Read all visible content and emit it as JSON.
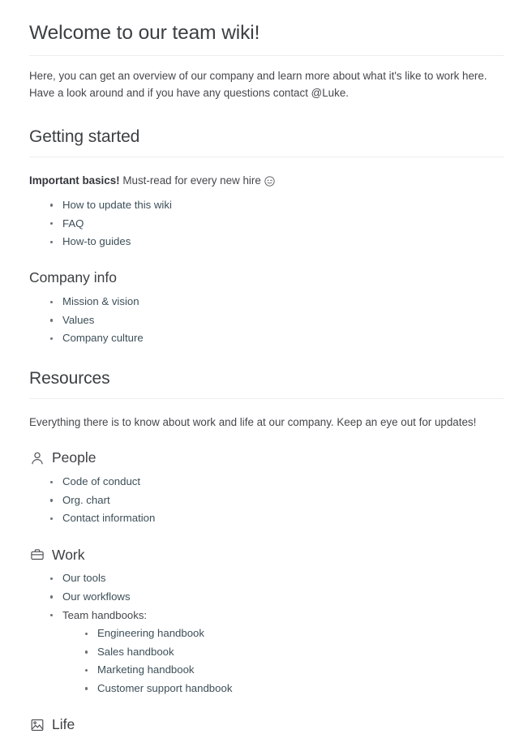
{
  "document": {
    "title": "Welcome to our team wiki!",
    "intro": "Here, you can get an overview of our company and learn more about what it's like to work here. Have a look around and if you have any questions contact @Luke."
  },
  "getting_started": {
    "heading": "Getting started",
    "lead_strong": "Important basics!",
    "lead_rest": " Must-read for every new hire ",
    "lead_emoji": "wink-face-icon",
    "links": [
      "How to update this wiki",
      "FAQ",
      "How-to guides"
    ],
    "company_info": {
      "heading": "Company info",
      "links": [
        "Mission & vision",
        "Values",
        "Company culture"
      ]
    }
  },
  "resources": {
    "heading": "Resources",
    "intro": "Everything there is to know about work and life at our company. Keep an eye out for updates!",
    "sections": [
      {
        "heading": "People",
        "icon": "person-bust-icon",
        "links": [
          "Code of conduct",
          "Org. chart",
          "Contact information"
        ]
      },
      {
        "heading": "Work",
        "icon": "briefcase-icon",
        "links": [
          "Our tools",
          "Our workflows"
        ],
        "group_label": "Team handbooks:",
        "group_links": [
          "Engineering handbook",
          "Sales handbook",
          "Marketing handbook",
          "Customer support handbook"
        ]
      },
      {
        "heading": "Life",
        "icon": "framed-picture-icon",
        "links": []
      }
    ]
  },
  "colors": {
    "text": "#36393d",
    "heading": "#3c4043",
    "link": "#3d4f58",
    "rule": "#edeeef",
    "bullet": "#6b7075"
  }
}
